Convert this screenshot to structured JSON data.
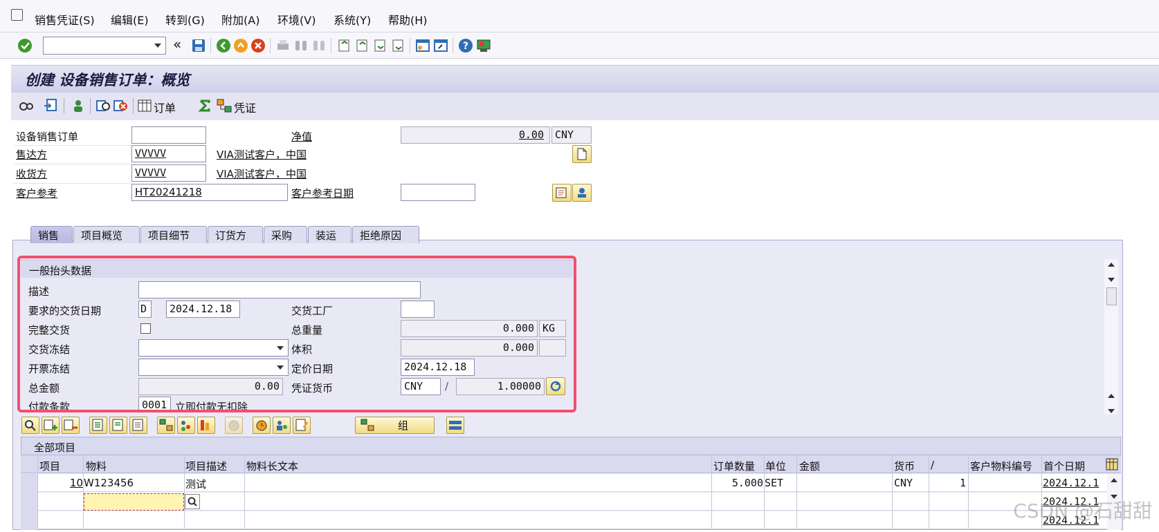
{
  "menu": [
    {
      "label": "销售凭证(S)"
    },
    {
      "label": "编辑(E)"
    },
    {
      "label": "转到(G)"
    },
    {
      "label": "附加(A)"
    },
    {
      "label": "环境(V)"
    },
    {
      "label": "系统(Y)"
    },
    {
      "label": "帮助(H)"
    }
  ],
  "toolbar": {
    "command_value": "",
    "collapse_glyph": "«"
  },
  "title": "创建 设备销售订单：概览",
  "app_toolbar": {
    "order_label": "订单",
    "document_label": "凭证"
  },
  "header": {
    "order_label": "设备销售订单",
    "order_value": "",
    "net_value_label": "净值",
    "net_value": "0.00",
    "net_currency": "CNY",
    "sold_to_label": "售达方",
    "sold_to_value": "VVVVV",
    "sold_to_desc": "VIA测试客户，中国",
    "ship_to_label": "收货方",
    "ship_to_value": "VVVVV",
    "ship_to_desc": "VIA测试客户，中国",
    "cust_ref_label": "客户参考",
    "cust_ref_value": "HT20241218",
    "cust_ref_date_label": "客户参考日期",
    "cust_ref_date_value": ""
  },
  "tabs": [
    {
      "label": "销售",
      "active": true
    },
    {
      "label": "项目概览"
    },
    {
      "label": "项目细节"
    },
    {
      "label": "订货方"
    },
    {
      "label": "采购"
    },
    {
      "label": "装运"
    },
    {
      "label": "拒绝原因"
    }
  ],
  "general": {
    "title": "一般抬头数据",
    "desc_label": "描述",
    "desc_value": "",
    "req_date_label": "要求的交货日期",
    "req_date_type": "D",
    "req_date_value": "2024.12.18",
    "plant_label": "交货工厂",
    "plant_value": "",
    "complete_label": "完整交货",
    "gross_weight_label": "总重量",
    "gross_weight_value": "0.000",
    "weight_unit": "KG",
    "delivery_block_label": "交货冻结",
    "delivery_block_value": "",
    "volume_label": "体积",
    "volume_value": "0.000",
    "volume_unit": "",
    "billing_block_label": "开票冻结",
    "billing_block_value": "",
    "pricing_date_label": "定价日期",
    "pricing_date_value": "2024.12.18",
    "total_label": "总金额",
    "total_value": "0.00",
    "doc_currency_label": "凭证货币",
    "doc_currency_value": "CNY",
    "rate_sep": "/",
    "rate_value": "1.00000",
    "payment_label": "付款条款",
    "payment_value": "0001",
    "payment_desc": "立即付款无扣除"
  },
  "items": {
    "title": "全部项目",
    "group_button": "组",
    "columns": [
      "项目",
      "物料",
      "项目描述",
      "物料长文本",
      "订单数量",
      "单位",
      "金额",
      "货币",
      "/",
      "客户物料编号",
      "首个日期"
    ],
    "rows": [
      {
        "item": "10",
        "material": "W123456",
        "desc": "测试",
        "long_text": "",
        "qty": "5.000",
        "unit": "SET",
        "amount": "",
        "currency": "CNY",
        "per": "1",
        "cust_mat": "",
        "first_date": "2024.12.1"
      },
      {
        "item": "",
        "material": "",
        "desc": "",
        "long_text": "",
        "qty": "",
        "unit": "",
        "amount": "",
        "currency": "",
        "per": "",
        "cust_mat": "",
        "first_date": "2024.12.1"
      },
      {
        "item": "",
        "material": "",
        "desc": "",
        "long_text": "",
        "qty": "",
        "unit": "",
        "amount": "",
        "currency": "",
        "per": "",
        "cust_mat": "",
        "first_date": "2024.12.1"
      }
    ]
  },
  "watermark": "CSDN @石甜甜",
  "colors": {
    "highlight": "#f0506e",
    "input_focus": "#fff4b0",
    "band": "#d9d9ef"
  }
}
